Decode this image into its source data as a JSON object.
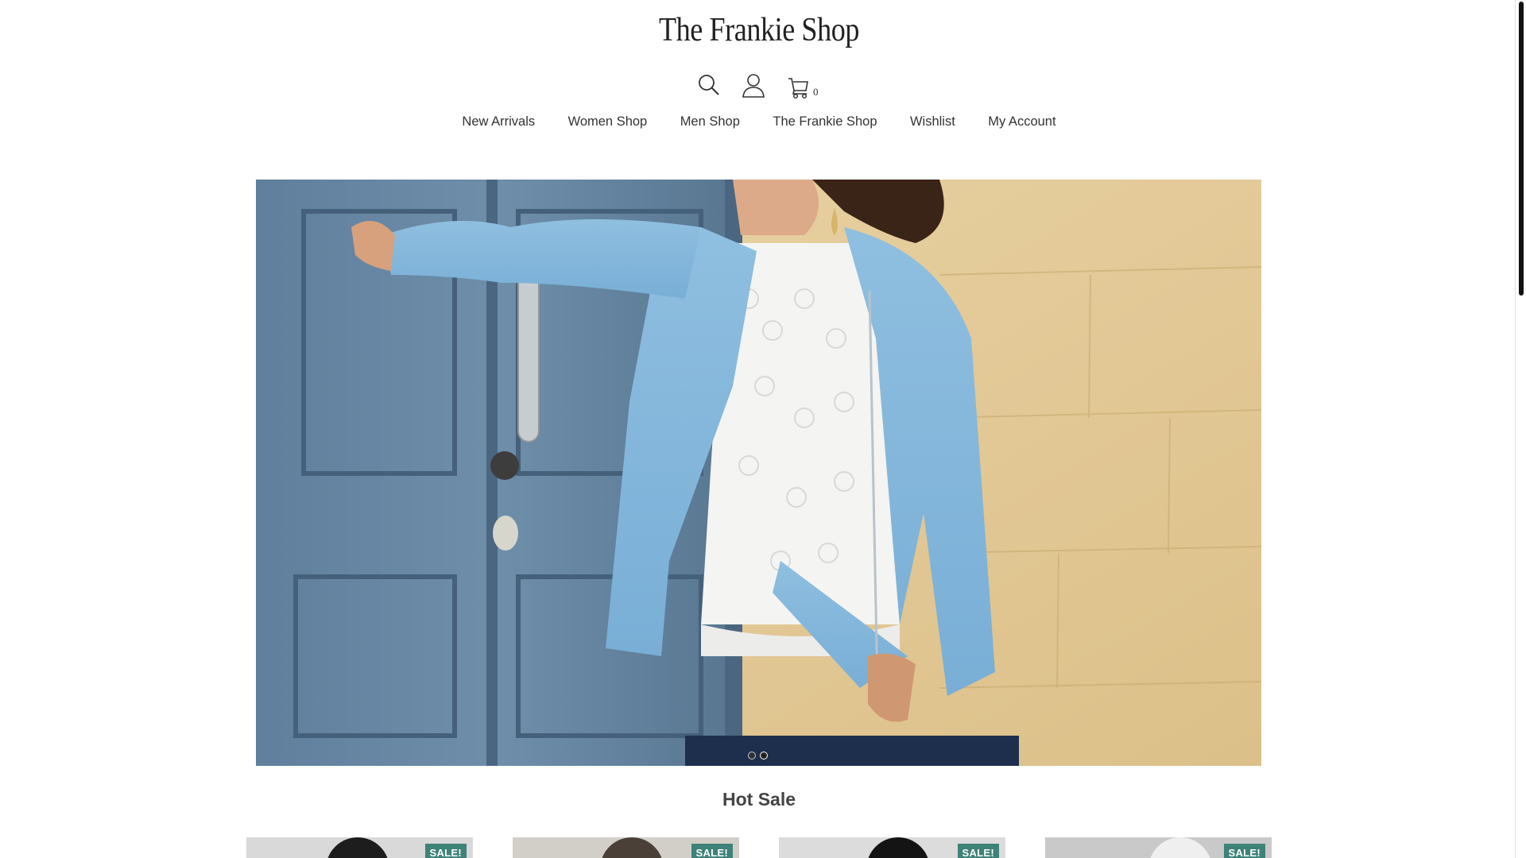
{
  "header": {
    "logo": "The Frankie Shop",
    "cart_count": "0",
    "icons": [
      "search-icon",
      "user-icon",
      "cart-icon"
    ]
  },
  "nav": {
    "items": [
      {
        "label": "New Arrivals"
      },
      {
        "label": "Women Shop"
      },
      {
        "label": "Men Shop"
      },
      {
        "label": "The Frankie Shop"
      },
      {
        "label": "Wishlist"
      },
      {
        "label": "My Account"
      }
    ]
  },
  "hero": {
    "slide_count": 2,
    "active_slide": 2
  },
  "hot_sale": {
    "title": "Hot Sale",
    "products": [
      {
        "badge": "SALE!"
      },
      {
        "badge": "SALE!"
      },
      {
        "badge": "SALE!"
      },
      {
        "badge": "SALE!"
      }
    ]
  },
  "colors": {
    "sale_badge": "#3e8278",
    "text": "#333333",
    "background": "#ffffff"
  }
}
